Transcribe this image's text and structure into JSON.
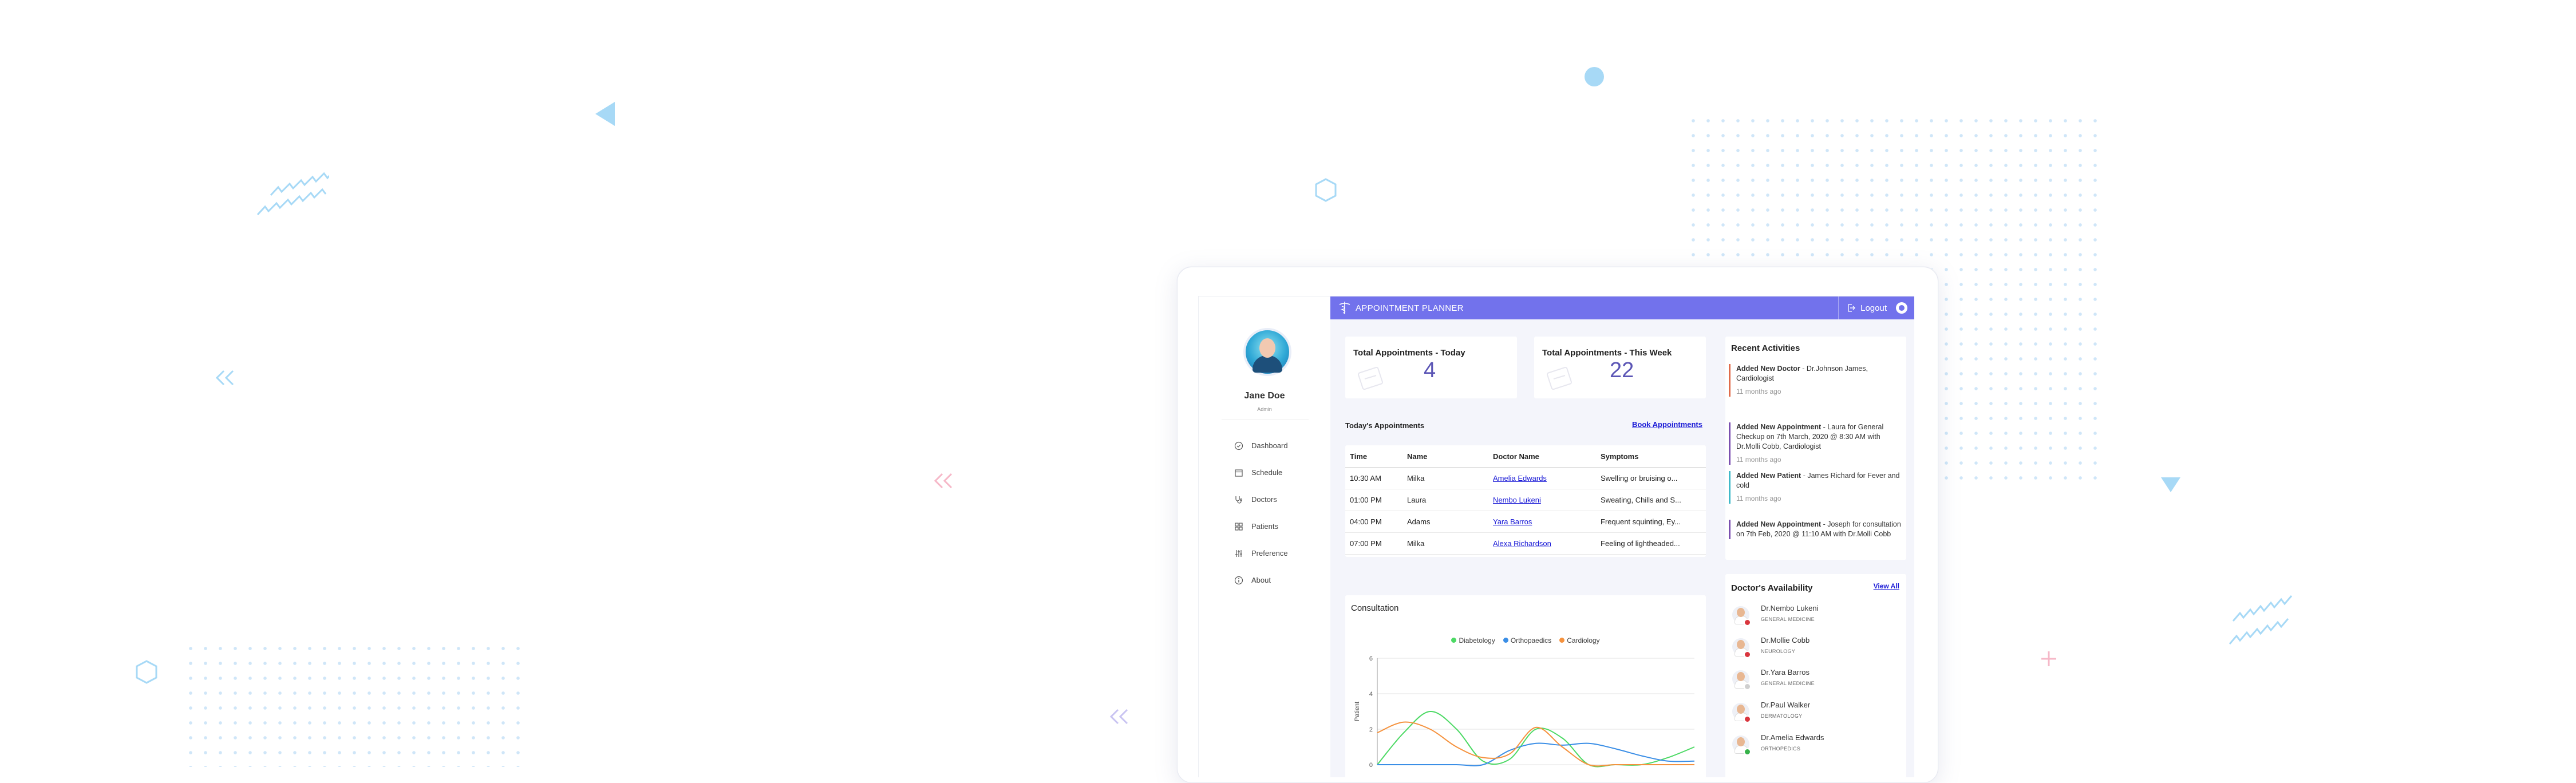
{
  "app": {
    "title": "APPOINTMENT PLANNER",
    "logout_label": "Logout"
  },
  "user": {
    "name": "Jane Doe",
    "role": "Admin"
  },
  "nav": [
    {
      "label": "Dashboard",
      "icon": "dashboard-icon"
    },
    {
      "label": "Schedule",
      "icon": "calendar-icon"
    },
    {
      "label": "Doctors",
      "icon": "stethoscope-icon"
    },
    {
      "label": "Patients",
      "icon": "patients-icon"
    },
    {
      "label": "Preference",
      "icon": "sliders-icon"
    },
    {
      "label": "About",
      "icon": "info-icon"
    }
  ],
  "stats": {
    "today_title": "Total Appointments - Today",
    "today_value": "4",
    "week_title": "Total Appointments - This Week",
    "week_value": "22"
  },
  "appointments": {
    "title": "Today's Appointments",
    "book_label": "Book Appointments",
    "columns": [
      "Time",
      "Name",
      "Doctor Name",
      "Symptoms"
    ],
    "rows": [
      {
        "time": "10:30 AM",
        "name": "Milka",
        "doctor": "Amelia Edwards",
        "symptoms": "Swelling or bruising o..."
      },
      {
        "time": "01:00 PM",
        "name": "Laura",
        "doctor": "Nembo Lukeni",
        "symptoms": "Sweating, Chills and S..."
      },
      {
        "time": "04:00 PM",
        "name": "Adams",
        "doctor": "Yara Barros",
        "symptoms": "Frequent squinting, Ey..."
      },
      {
        "time": "07:00 PM",
        "name": "Milka",
        "doctor": "Alexa Richardson",
        "symptoms": "Feeling of lightheaded..."
      }
    ]
  },
  "activities": {
    "title": "Recent Activities",
    "items": [
      {
        "head": "Added New Doctor",
        "text": " - Dr.Johnson James, Cardiologist",
        "time": "11 months ago",
        "color": "#e06b4a"
      },
      {
        "head": "Added New Appointment",
        "text": " - Laura for General Checkup on 7th March, 2020 @ 8:30 AM with Dr.Molli Cobb, Cardiologist",
        "time": "11 months ago",
        "color": "#7a4fb0"
      },
      {
        "head": "Added New Patient",
        "text": " - James Richard for Fever and cold",
        "time": "11 months ago",
        "color": "#3fb9c9"
      },
      {
        "head": "Added New Appointment",
        "text": " - Joseph for consultation on 7th Feb, 2020 @ 11:10 AM with Dr.Molli Cobb",
        "time": "",
        "color": "#7a4fb0"
      }
    ]
  },
  "availability": {
    "title": "Doctor's Availability",
    "view_all": "View All",
    "doctors": [
      {
        "name": "Dr.Nembo Lukeni",
        "specialty": "GENERAL MEDICINE",
        "status_color": "#d9363e"
      },
      {
        "name": "Dr.Mollie Cobb",
        "specialty": "NEUROLOGY",
        "status_color": "#d9363e"
      },
      {
        "name": "Dr.Yara Barros",
        "specialty": "GENERAL MEDICINE",
        "status_color": "#cfcfcf"
      },
      {
        "name": "Dr.Paul Walker",
        "specialty": "DERMATOLOGY",
        "status_color": "#d9363e"
      },
      {
        "name": "Dr.Amelia Edwards",
        "specialty": "ORTHOPEDICS",
        "status_color": "#36b24a"
      }
    ]
  },
  "chart_data": {
    "type": "line",
    "title": "Consultation",
    "ylabel": "Patient",
    "xlabel": "",
    "ylim": [
      0,
      6
    ],
    "yticks": [
      "0",
      "2",
      "4",
      "6"
    ],
    "grid": true,
    "legend_position": "top-center",
    "x": [
      0,
      1,
      2,
      3,
      4,
      5,
      6,
      7,
      8,
      9,
      10,
      11,
      12
    ],
    "series": [
      {
        "name": "Diabetology",
        "color": "#4cd964",
        "values": [
          0,
          1.8,
          3,
          2,
          0.2,
          0.3,
          2,
          1.5,
          0,
          0,
          0,
          0.4,
          1
        ]
      },
      {
        "name": "Orthopaedics",
        "color": "#3a8ee6",
        "values": [
          0,
          0,
          0,
          0,
          0,
          0.8,
          1.2,
          1.1,
          1.2,
          0.9,
          0.5,
          0.2,
          0.2
        ]
      },
      {
        "name": "Cardiology",
        "color": "#f5923e",
        "values": [
          1.8,
          2.4,
          2,
          1,
          0.4,
          0.6,
          2.1,
          1,
          0,
          0,
          0,
          0,
          0
        ]
      }
    ]
  }
}
